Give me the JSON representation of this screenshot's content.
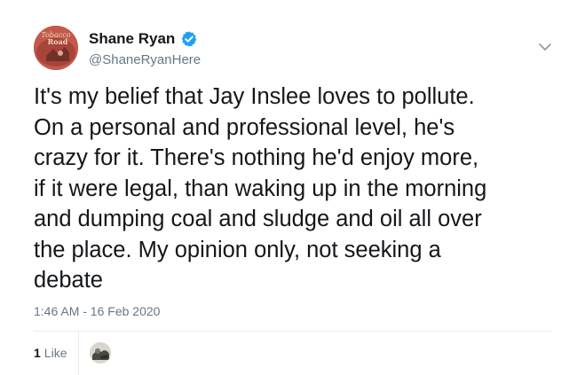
{
  "tweet": {
    "display_name": "Shane Ryan",
    "handle": "@ShaneRyanHere",
    "verified": true,
    "avatar_text_line1": "Tobacco",
    "avatar_text_line2": "Road",
    "text": "It's my belief that Jay Inslee loves to pollute.\nOn a personal and professional level, he's\ncrazy for it. There's nothing he'd enjoy more,\nif it were legal, than waking up in the morning\nand dumping coal and sludge and oil all over\nthe place. My opinion only, not seeking a\ndebate",
    "timestamp": "1:46 AM - 16 Feb 2020"
  },
  "stats": {
    "likes_count": "1",
    "likes_label": "Like"
  },
  "icons": {
    "verified": "verified-badge-icon",
    "menu": "chevron-down-icon"
  },
  "colors": {
    "text": "#14171a",
    "secondary": "#657786",
    "verified_blue": "#1da1f2",
    "divider": "#e6ecf0"
  }
}
